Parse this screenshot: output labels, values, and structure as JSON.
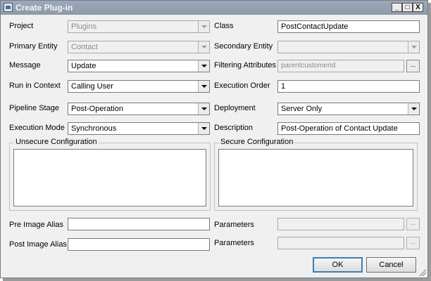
{
  "window": {
    "title": "Create Plug-in"
  },
  "left": {
    "project": {
      "label": "Project",
      "value": "Plugins"
    },
    "primary_entity": {
      "label": "Primary Entity",
      "value": "Contact"
    },
    "message": {
      "label": "Message",
      "value": "Update"
    },
    "run_in_context": {
      "label": "Run in Context",
      "value": "Calling User"
    },
    "pipeline_stage": {
      "label": "Pipeline Stage",
      "value": "Post-Operation"
    },
    "execution_mode": {
      "label": "Execution Mode",
      "value": "Synchronous"
    },
    "unsecure_config": {
      "label": "Unsecure Configuration",
      "value": ""
    },
    "pre_image_alias": {
      "label": "Pre Image Alias",
      "value": ""
    },
    "post_image_alias": {
      "label": "Post Image Alias",
      "value": ""
    }
  },
  "right": {
    "class": {
      "label": "Class",
      "value": "PostContactUpdate"
    },
    "secondary_entity": {
      "label": "Secondary Entity",
      "value": ""
    },
    "filtering_attributes": {
      "label": "Filtering Attributes",
      "value": "parentcustomerid",
      "button": "..."
    },
    "execution_order": {
      "label": "Execution Order",
      "value": "1"
    },
    "deployment": {
      "label": "Deployment",
      "value": "Server Only"
    },
    "description": {
      "label": "Description",
      "value": "Post-Operation of Contact Update"
    },
    "secure_config": {
      "label": "Secure Configuration",
      "value": ""
    },
    "pre_parameters": {
      "label": "Parameters",
      "value": "",
      "button": "..."
    },
    "post_parameters": {
      "label": "Parameters",
      "value": "",
      "button": "..."
    }
  },
  "buttons": {
    "ok": "OK",
    "cancel": "Cancel"
  },
  "titlebar_buttons": {
    "minimize": "_",
    "maximize": "□",
    "close": "X"
  }
}
